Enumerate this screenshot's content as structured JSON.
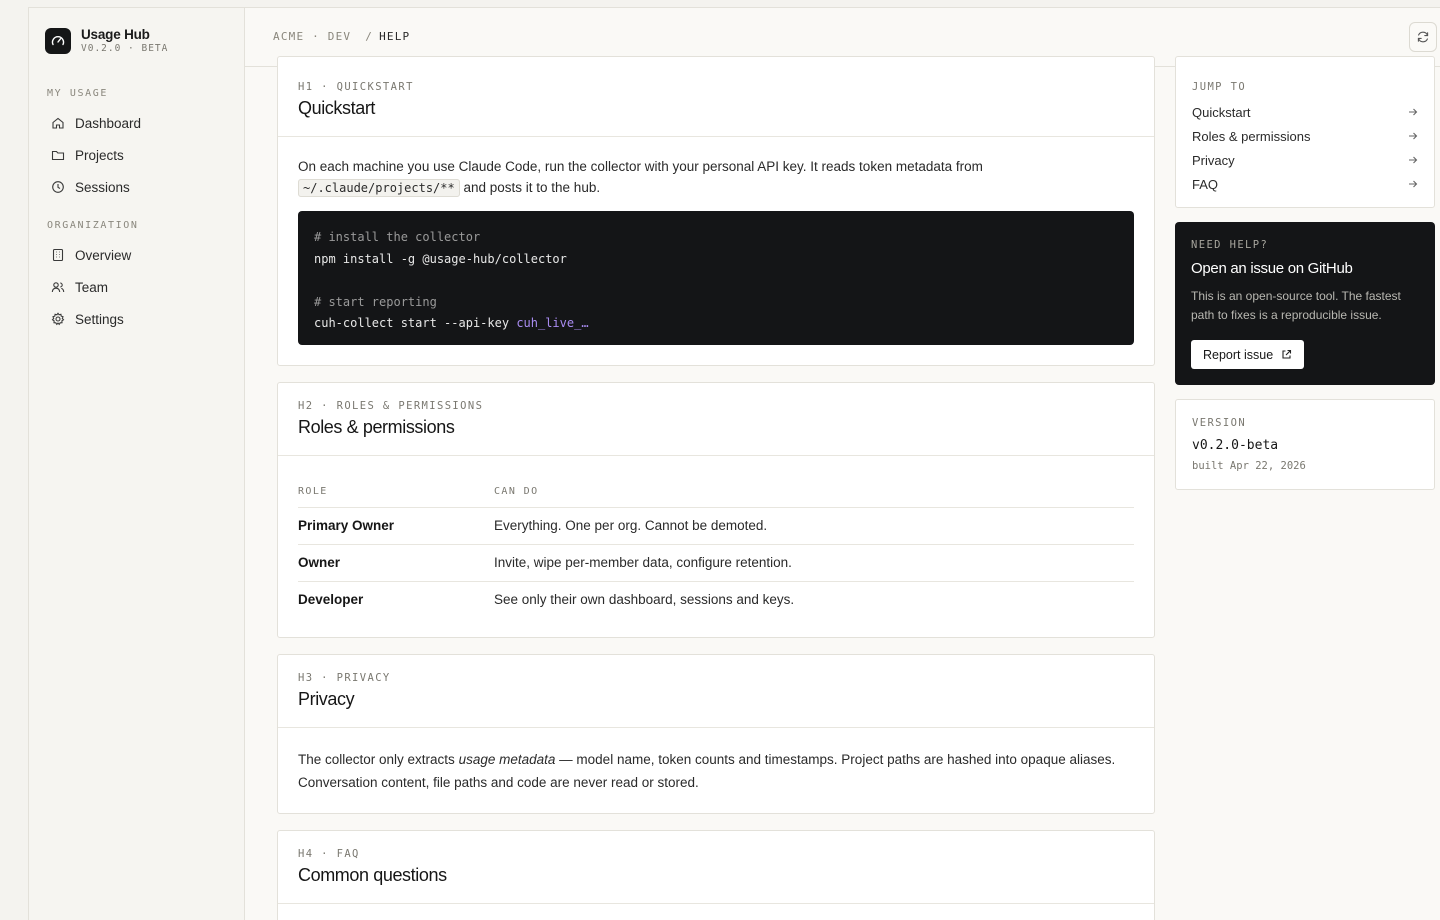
{
  "brand": {
    "name": "Usage Hub",
    "version": "V0.2.0 · BETA"
  },
  "sidebar": {
    "sections": [
      {
        "label": "MY USAGE",
        "items": [
          {
            "label": "Dashboard",
            "icon": "home-icon"
          },
          {
            "label": "Projects",
            "icon": "folder-icon"
          },
          {
            "label": "Sessions",
            "icon": "clock-icon"
          }
        ]
      },
      {
        "label": "ORGANIZATION",
        "items": [
          {
            "label": "Overview",
            "icon": "building-icon"
          },
          {
            "label": "Team",
            "icon": "users-icon"
          },
          {
            "label": "Settings",
            "icon": "gear-icon"
          }
        ]
      }
    ]
  },
  "breadcrumb": {
    "org": "ACME · DEV",
    "separator": "/",
    "current": "HELP"
  },
  "quickstart": {
    "eyebrow": "H1 · QUICKSTART",
    "title": "Quickstart",
    "text_before": "On each machine you use Claude Code, run the collector with your personal API key. It reads token metadata from",
    "path": "~/.claude/projects/**",
    "text_after": "and posts it to the hub.",
    "code": {
      "comment1": "# install the collector",
      "line1": "npm install -g @usage-hub/collector",
      "comment2": "# start reporting",
      "line2_cmd": "cuh-collect start --api-key",
      "line2_key": "cuh_live_…"
    }
  },
  "roles": {
    "eyebrow": "H2 · ROLES & PERMISSIONS",
    "title": "Roles & permissions",
    "headers": [
      "ROLE",
      "CAN DO"
    ],
    "rows": [
      {
        "role": "Primary Owner",
        "can_do": "Everything. One per org. Cannot be demoted."
      },
      {
        "role": "Owner",
        "can_do": "Invite, wipe per-member data, configure retention."
      },
      {
        "role": "Developer",
        "can_do": "See only their own dashboard, sessions and keys."
      }
    ]
  },
  "privacy": {
    "eyebrow": "H3 · PRIVACY",
    "title": "Privacy",
    "text_before": "The collector only extracts",
    "emphasis": "usage metadata",
    "text_after": "— model name, token counts and timestamps. Project paths are hashed into opaque aliases. Conversation content, file paths and code are never read or stored."
  },
  "faq": {
    "eyebrow": "H4 · FAQ",
    "title": "Common questions"
  },
  "jump_to": {
    "label": "JUMP TO",
    "items": [
      "Quickstart",
      "Roles & permissions",
      "Privacy",
      "FAQ"
    ]
  },
  "help": {
    "eyebrow": "NEED HELP?",
    "title": "Open an issue on GitHub",
    "text": "This is an open-source tool. The fastest path to fixes is a reproducible issue.",
    "button": "Report issue"
  },
  "version": {
    "label": "VERSION",
    "value": "v0.2.0-beta",
    "built": "built Apr 22, 2026"
  }
}
